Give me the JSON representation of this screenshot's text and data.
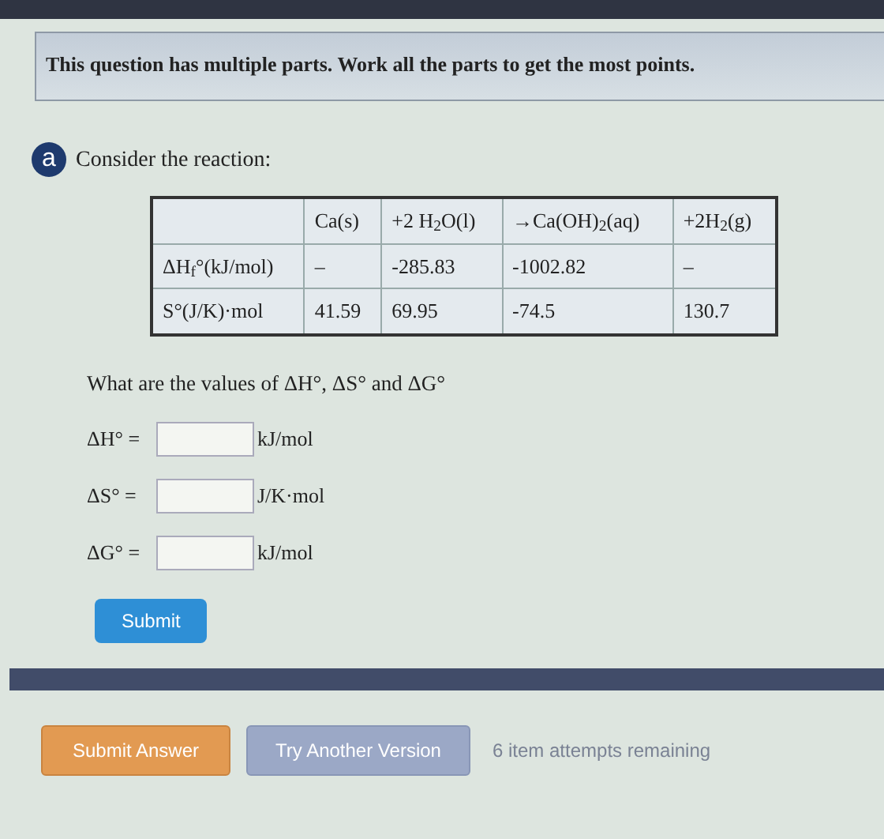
{
  "instructions": "This question has multiple parts. Work all the parts to get the most points.",
  "part": {
    "letter": "a",
    "prompt": "Consider the reaction:"
  },
  "table": {
    "columns": [
      "Ca(s)",
      "+2 H$_{2}$O(l)",
      "→Ca(OH)$_{2}$(aq)",
      "+2H$_{2}$(g)"
    ],
    "rows": [
      {
        "label": "ΔH$_{f}$°(kJ/mol)",
        "cells": [
          "–",
          "-285.83",
          "-1002.82",
          "–"
        ]
      },
      {
        "label": "S°(J/K)·mol",
        "cells": [
          "41.59",
          "69.95",
          "-74.5",
          "130.7"
        ]
      }
    ]
  },
  "question": "What are the values of ΔH°, ΔS° and ΔG°",
  "answers": [
    {
      "label": "ΔH° =",
      "unit": "kJ/mol"
    },
    {
      "label": "ΔS° =",
      "unit": "J/K·mol"
    },
    {
      "label": "ΔG° =",
      "unit": "kJ/mol"
    }
  ],
  "submit": "Submit",
  "buttons": [
    {
      "label": "Submit Answer",
      "kind": "primary"
    },
    {
      "label": "Try Another Version",
      "kind": "secondary"
    }
  ],
  "attempts": "6 item attempts remaining"
}
